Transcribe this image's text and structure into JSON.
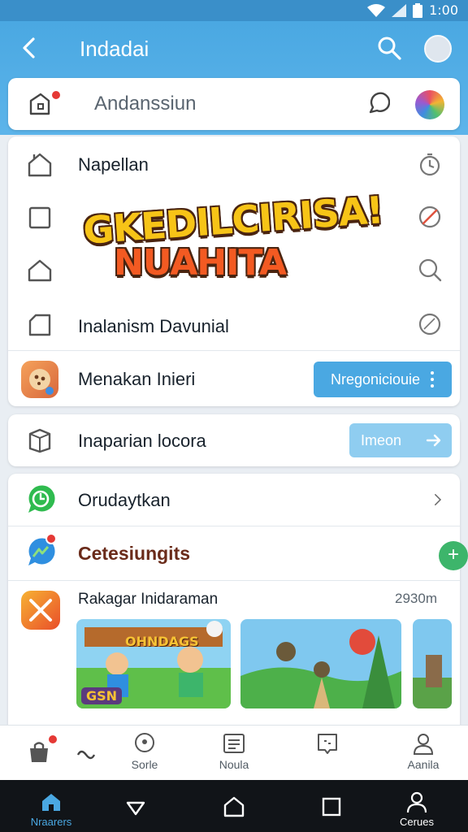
{
  "status_bar": {
    "time": "1:00"
  },
  "header": {
    "title": "Indadai",
    "search_placeholder": "Andanssiun"
  },
  "menu": {
    "items": [
      {
        "label": "Napellan",
        "icon": "home-icon",
        "right_icon": "timer-icon"
      },
      {
        "label": "",
        "icon": "checkbox-icon",
        "right_icon": "slash-circle-icon"
      },
      {
        "label": "",
        "icon": "house-icon",
        "right_icon": "zoom-icon"
      },
      {
        "label": "Inalanism Davunial",
        "icon": "folder-icon",
        "right_icon": "circle-icon"
      }
    ],
    "banner": {
      "line1": "GKEDILCIRISA!",
      "line2": "NUAHITA"
    },
    "app_row": {
      "label": "Menakan Inieri",
      "button_label": "Nregoniciouie",
      "button_icon": "more-vert-icon"
    }
  },
  "install_row": {
    "label": "Inaparian locora",
    "button_label": "Imeon",
    "button_icon": "arrow-right-icon"
  },
  "messages": {
    "row_label": "Orudaytkan",
    "section_title": "Cetesiungits",
    "fab_label": "+",
    "feed_title": "Rakagar Inidaraman",
    "feed_time": "2930m",
    "thumb_sign": "OHNDAGS",
    "thumb_tag": "GSN"
  },
  "bottom_tabs": [
    {
      "label": "",
      "icon": "bag-icon"
    },
    {
      "label": "",
      "icon": "infinity-icon"
    },
    {
      "label": "Sorle",
      "icon": "location-icon"
    },
    {
      "label": "Noula",
      "icon": "list-icon"
    },
    {
      "label": "",
      "icon": "card-icon"
    },
    {
      "label": "Aanila",
      "icon": "person-icon"
    }
  ],
  "nav_bar": [
    {
      "label": "Nraarers",
      "icon": "home-nav-icon"
    },
    {
      "label": "",
      "icon": "back-nav-icon"
    },
    {
      "label": "",
      "icon": "home-outline-icon"
    },
    {
      "label": "",
      "icon": "recent-icon"
    },
    {
      "label": "Cerues",
      "icon": "profile-nav-icon"
    }
  ],
  "colors": {
    "primary": "#4aa8e2",
    "accent_green": "#3db56b",
    "badge_red": "#e53935",
    "section_title": "#6a2b1a"
  }
}
